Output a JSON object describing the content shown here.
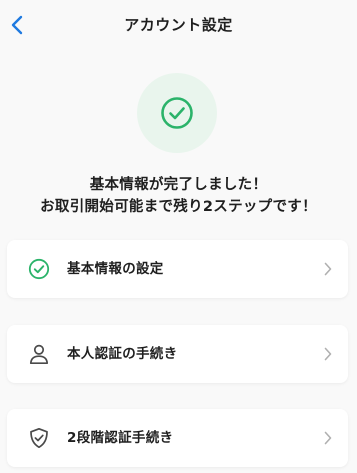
{
  "header": {
    "title": "アカウント設定"
  },
  "colors": {
    "accent_blue": "#1f7ae0",
    "success_green": "#2bb36a",
    "success_bg": "#e9f5ed",
    "chevron_gray": "#b0b0b0",
    "icon_dark": "#4a4a4a"
  },
  "message": {
    "line1": "基本情報が完了しました！",
    "line2": "お取引開始可能まで残り2ステップです！"
  },
  "steps": [
    {
      "label": "基本情報の設定",
      "icon": "check-circle-icon",
      "completed": true
    },
    {
      "label": "本人認証の手続き",
      "icon": "person-icon",
      "completed": false
    },
    {
      "label": "2段階認証手続き",
      "icon": "shield-check-icon",
      "completed": false
    }
  ]
}
